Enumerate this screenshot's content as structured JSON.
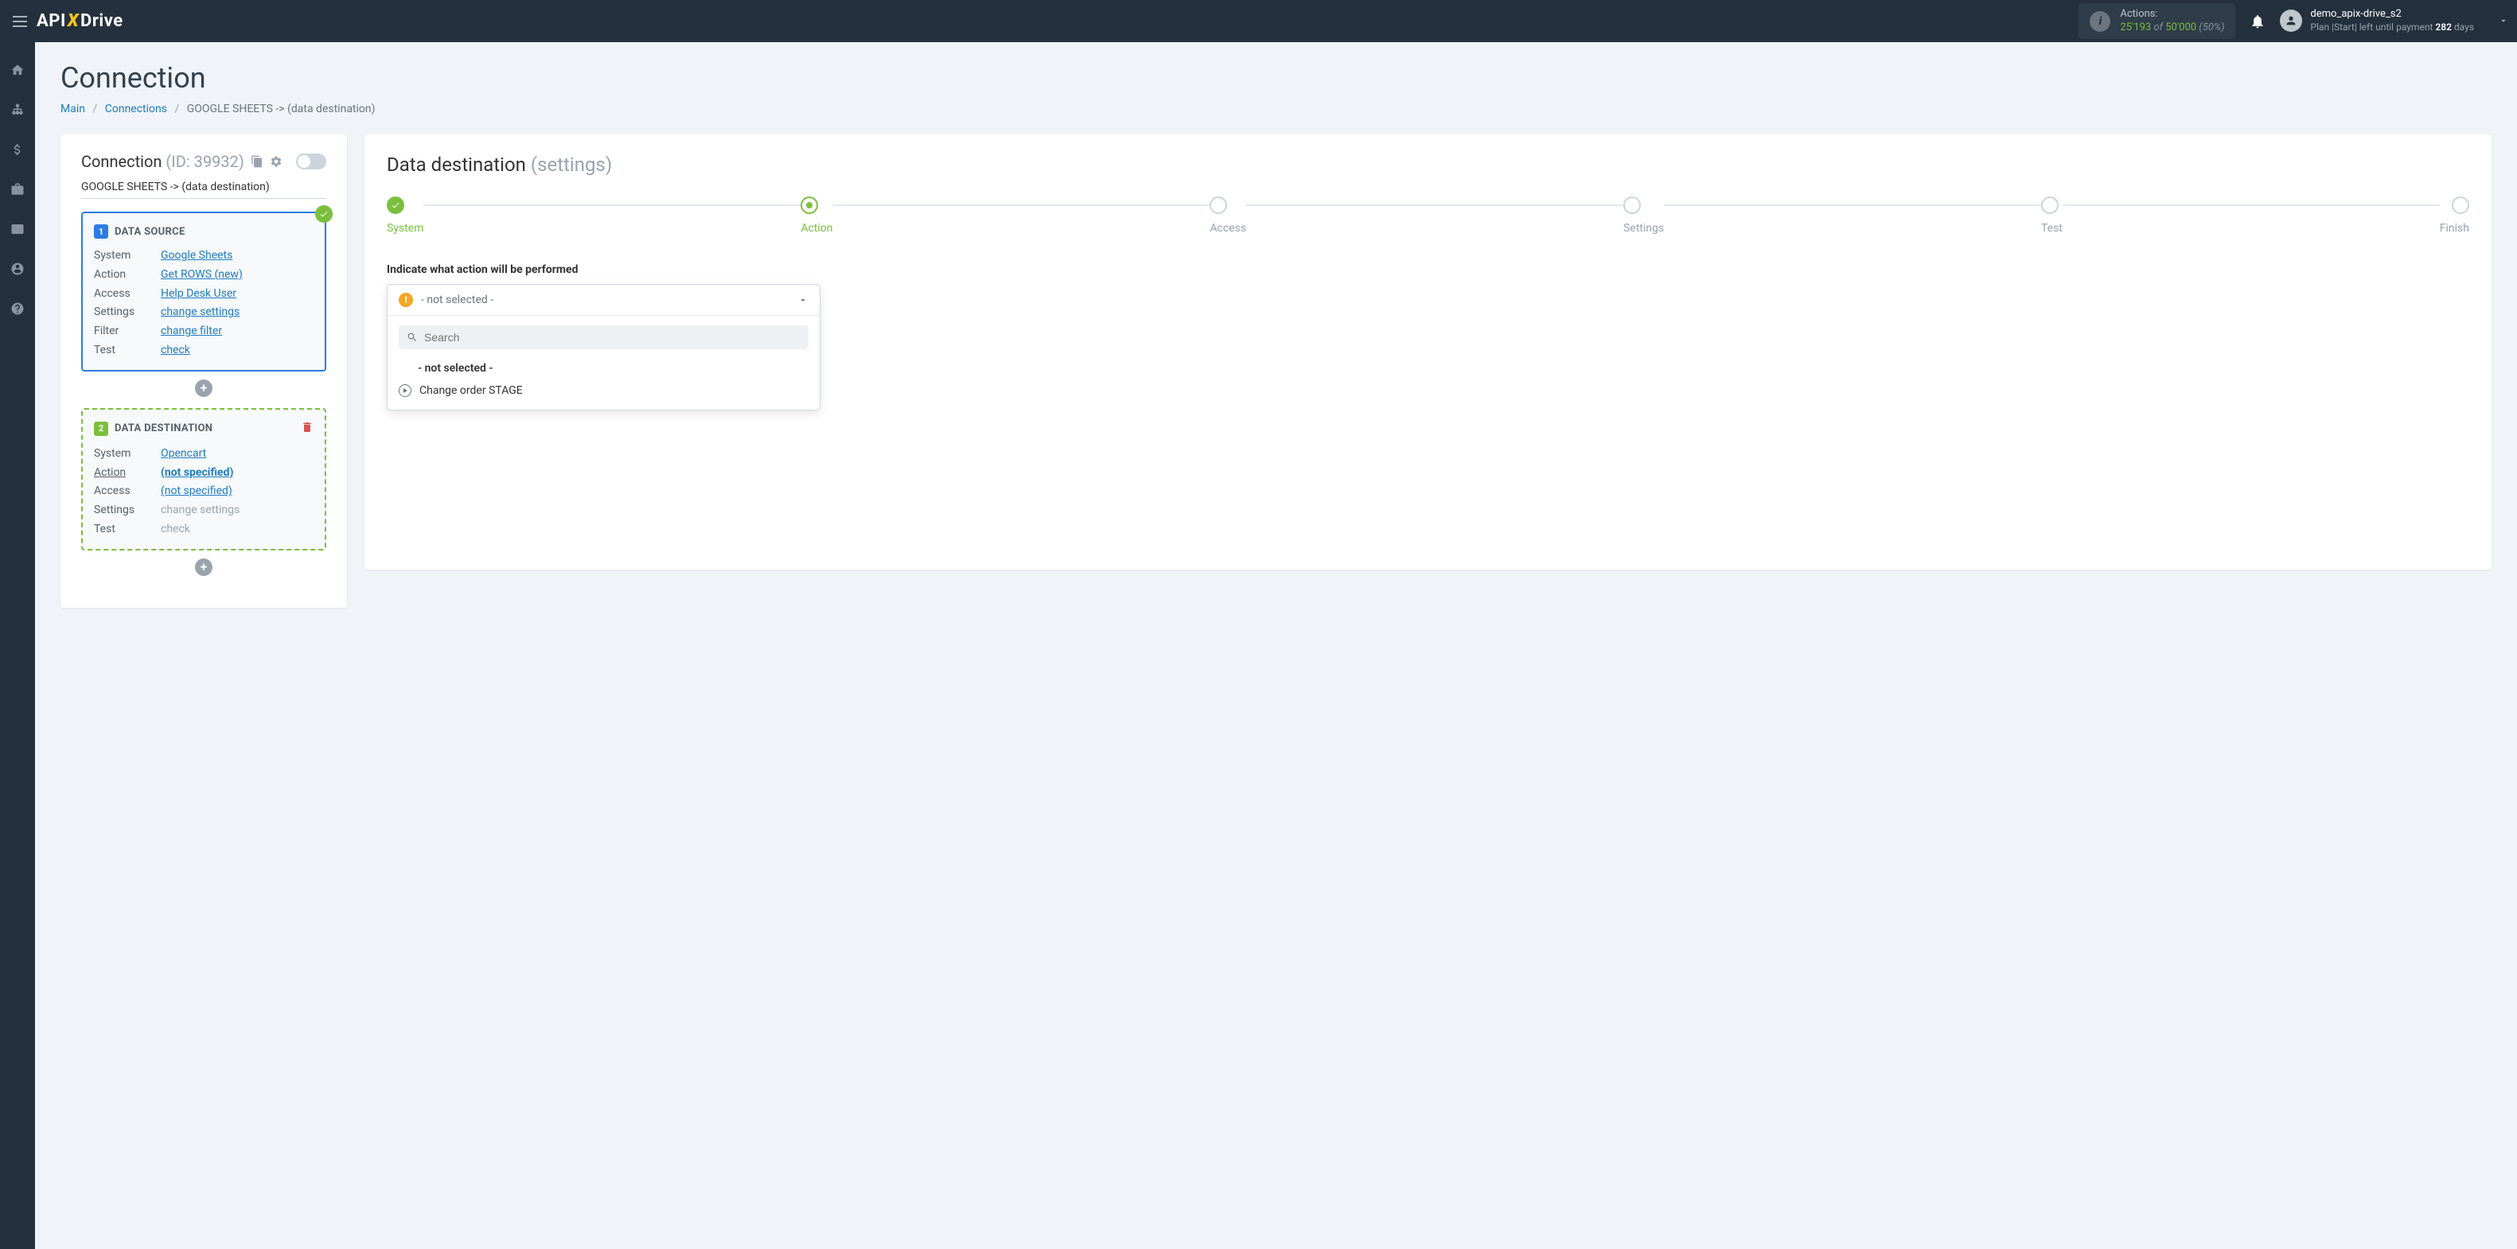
{
  "topbar": {
    "actions_label": "Actions:",
    "actions_used": "25'193",
    "actions_of": "of",
    "actions_total": "50'000",
    "actions_pct": "(50%)",
    "username": "demo_apix-drive_s2",
    "plan_prefix": "Plan |Start| left until payment ",
    "plan_days": "282",
    "plan_suffix": " days"
  },
  "page": {
    "title": "Connection",
    "breadcrumb": {
      "main": "Main",
      "connections": "Connections",
      "current": "GOOGLE SHEETS -> (data destination)"
    }
  },
  "left": {
    "conn_label": "Connection",
    "conn_id": "(ID: 39932)",
    "conn_name": "GOOGLE SHEETS -> (data destination)",
    "source": {
      "num": "1",
      "title": "DATA SOURCE",
      "rows": [
        {
          "k": "System",
          "v": "Google Sheets"
        },
        {
          "k": "Action",
          "v": "Get ROWS (new)"
        },
        {
          "k": "Access",
          "v": "Help Desk User"
        },
        {
          "k": "Settings",
          "v": "change settings"
        },
        {
          "k": "Filter",
          "v": "change filter"
        },
        {
          "k": "Test",
          "v": "check"
        }
      ]
    },
    "dest": {
      "num": "2",
      "title": "DATA DESTINATION",
      "rows": [
        {
          "k": "System",
          "v": "Opencart",
          "link": true
        },
        {
          "k": "Action",
          "v": "(not specified)",
          "bold": true,
          "ku": true
        },
        {
          "k": "Access",
          "v": "(not specified)",
          "link": true
        },
        {
          "k": "Settings",
          "v": "change settings",
          "muted": true
        },
        {
          "k": "Test",
          "v": "check",
          "muted": true
        }
      ]
    }
  },
  "right": {
    "title": "Data destination",
    "subtitle": "(settings)",
    "steps": [
      "System",
      "Action",
      "Access",
      "Settings",
      "Test",
      "Finish"
    ],
    "field_label": "Indicate what action will be performed",
    "selected": "- not selected -",
    "search_placeholder": "Search",
    "options": {
      "not_selected": "- not selected -",
      "change_order": "Change order STAGE"
    }
  }
}
